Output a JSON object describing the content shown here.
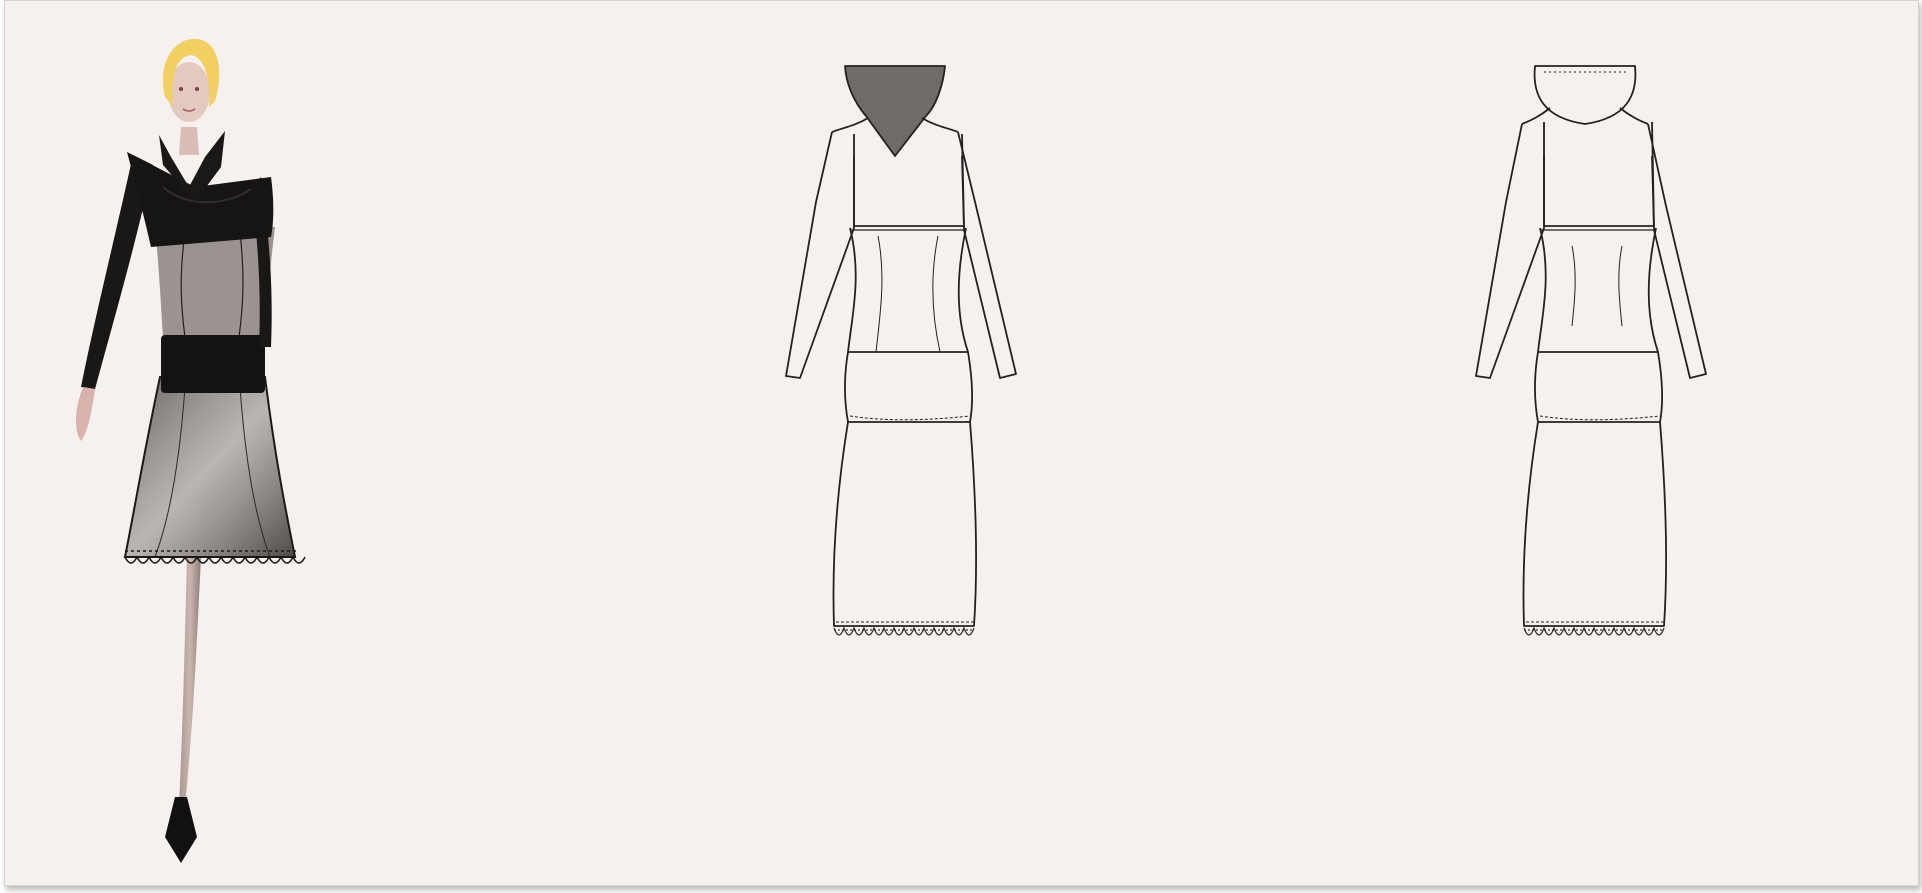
{
  "canvas": {
    "paper_color": "#f6f1ee",
    "line_color": "#222222",
    "collar_fill": "#6f6b69"
  },
  "illustration": {
    "hair_color": "#f2cf62",
    "garment_color": "#141212",
    "sheer_color": "#8c8784",
    "skin_color": "#d6b9b0",
    "shoe_color": "#111111"
  },
  "flats": [
    {
      "view": "front",
      "collar": "v-neck-shaded",
      "hem": "lace-scallop"
    },
    {
      "view": "back",
      "collar": "funnel",
      "hem": "lace-scallop"
    }
  ]
}
